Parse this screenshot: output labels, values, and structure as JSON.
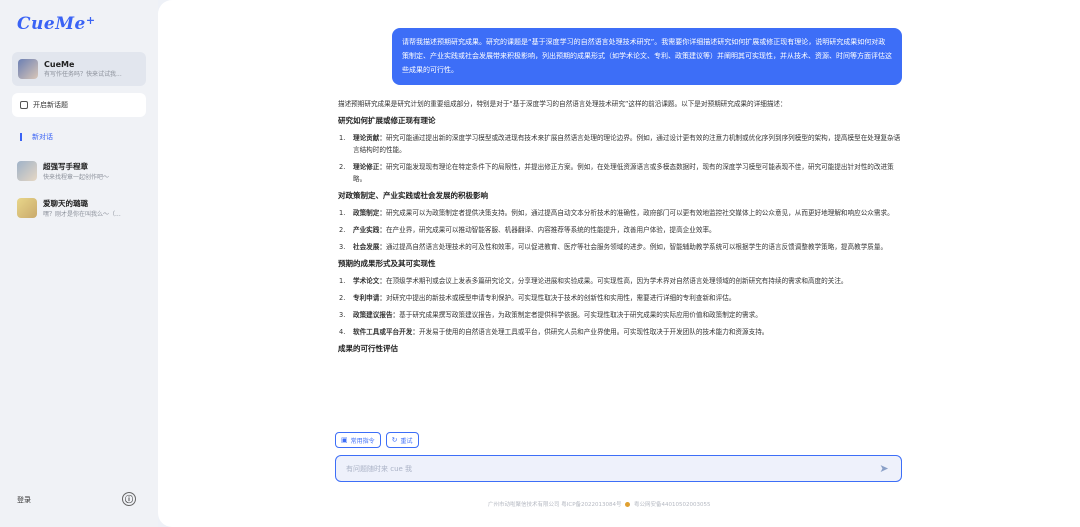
{
  "app": {
    "logo": "CueMe",
    "logo_plus": "+"
  },
  "sidebar": {
    "profile": {
      "name": "CueMe",
      "subtitle": "有写作任务吗？快来试试我..."
    },
    "new_chat_label": "开启新话题",
    "current_conversation": "新对话",
    "agents": [
      {
        "name": "超强写手程章",
        "subtitle": "快来找程章一起创作吧～"
      },
      {
        "name": "爱聊天的璐璐",
        "subtitle": "嘿？刚才是你在叫我么～（..."
      }
    ],
    "login_label": "登录",
    "info_icon": "ⓘ"
  },
  "chat": {
    "user_message": "请帮我描述预期研究成果。研究的课题是“基于深度学习的自然语言处理技术研究”。我需要你详细描述研究如何扩展或修正现有理论，说明研究成果如何对政策制定、产业实践或社会发展带来积极影响，列出预期的成果形式（如学术论文、专利、政策建议等）并阐明其可实现性，并从技术、资源、时间等方面评估这些成果的可行性。",
    "answer": {
      "intro": "描述预期研究成果是研究计划的重要组成部分，特别是对于“基于深度学习的自然语言处理技术研究”这样的前沿课题。以下是对预期研究成果的详细描述：",
      "sections": [
        {
          "heading": "研究如何扩展或修正现有理论",
          "items": [
            {
              "num": "1.",
              "title": "理论贡献：",
              "text": "研究可能通过提出新的深度学习模型或改进现有技术来扩展自然语言处理的理论边界。例如，通过设计更有效的注意力机制或优化序列到序列模型的架构，提高模型在处理复杂语言结构时的性能。"
            },
            {
              "num": "2.",
              "title": "理论修正：",
              "text": "研究可能发现现有理论在特定条件下的局限性，并提出修正方案。例如，在处理低资源语言或多模态数据时，现有的深度学习模型可能表现不佳，研究可能提出针对性的改进策略。"
            }
          ]
        },
        {
          "heading": "对政策制定、产业实践或社会发展的积极影响",
          "items": [
            {
              "num": "1.",
              "title": "政策制定：",
              "text": "研究成果可以为政策制定者提供决策支持。例如，通过提高自动文本分析技术的准确性，政府部门可以更有效地监控社交媒体上的公众意见，从而更好地理解和响应公众需求。"
            },
            {
              "num": "2.",
              "title": "产业实践：",
              "text": "在产业界，研究成果可以推动智能客服、机器翻译、内容推荐等系统的性能提升，改善用户体验，提高企业效率。"
            },
            {
              "num": "3.",
              "title": "社会发展：",
              "text": "通过提高自然语言处理技术的可及性和效率，可以促进教育、医疗等社会服务领域的进步。例如，智能辅助教学系统可以根据学生的语言反馈调整教学策略，提高教学质量。"
            }
          ]
        },
        {
          "heading": "预期的成果形式及其可实现性",
          "items": [
            {
              "num": "1.",
              "title": "学术论文：",
              "text": "在顶级学术期刊或会议上发表多篇研究论文，分享理论进展和实验成果。可实现性高，因为学术界对自然语言处理领域的创新研究有持续的需求和高度的关注。"
            },
            {
              "num": "2.",
              "title": "专利申请：",
              "text": "对研究中提出的新技术或模型申请专利保护。可实现性取决于技术的创新性和实用性，需要进行详细的专利查新和评估。"
            },
            {
              "num": "3.",
              "title": "政策建议报告：",
              "text": "基于研究成果撰写政策建议报告，为政策制定者提供科学依据。可实现性取决于研究成果的实际应用价值和政策制定的需求。"
            },
            {
              "num": "4.",
              "title": "软件工具或平台开发：",
              "text": "开发易于使用的自然语言处理工具或平台，供研究人员和产业界使用。可实现性取决于开发团队的技术能力和资源支持。"
            }
          ]
        },
        {
          "heading": "成果的可行性评估",
          "items": []
        }
      ]
    }
  },
  "composer": {
    "chip_common": "常用指令",
    "chip_retry": "重试",
    "placeholder": "有问题随时来 cue 我",
    "send_icon": "➤"
  },
  "footer": {
    "company": "广州市动啦聚信技术有限公司 粤ICP备2022013084号",
    "police": "粤公网安备44010502003055"
  }
}
